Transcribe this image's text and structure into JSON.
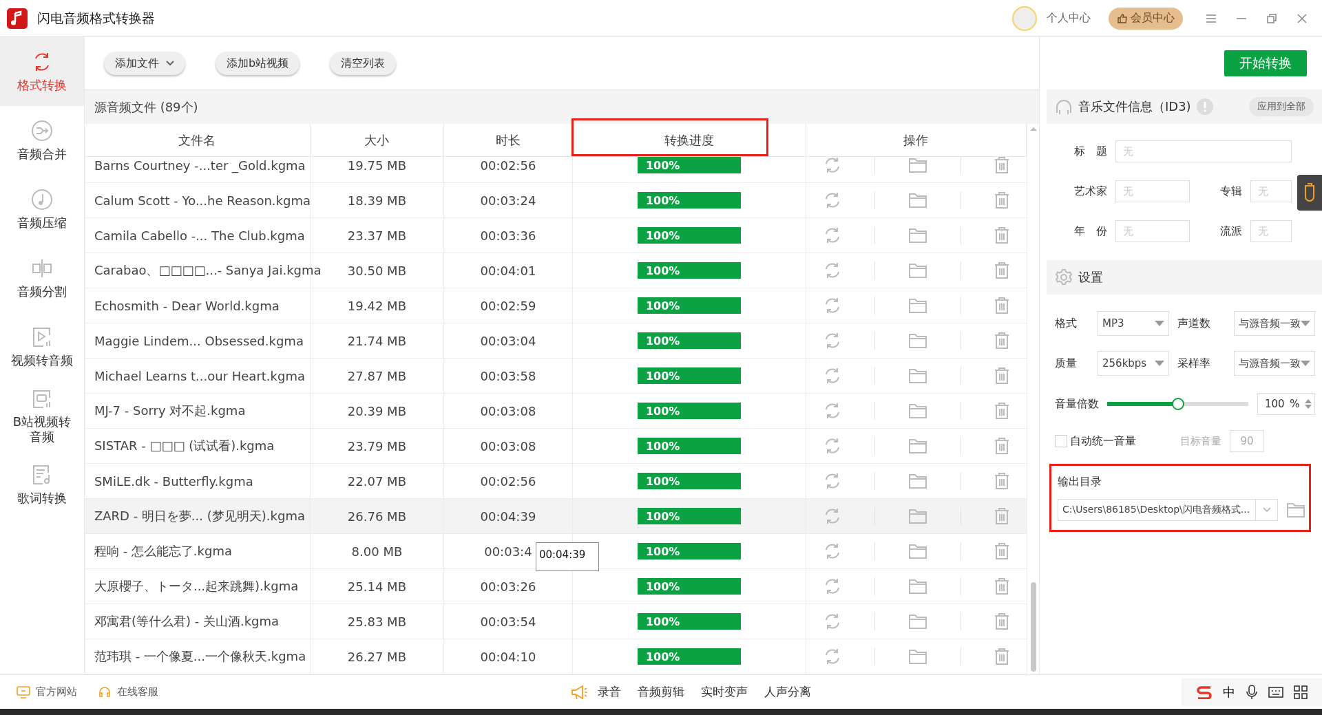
{
  "window": {
    "title": "闪电音频格式转换器",
    "user_label": "个人中心",
    "vip_button": "会员中心"
  },
  "sidebar": {
    "items": [
      {
        "label": "格式转换",
        "selected": true
      },
      {
        "label": "音频合并",
        "selected": false
      },
      {
        "label": "音频压缩",
        "selected": false
      },
      {
        "label": "音频分割",
        "selected": false
      },
      {
        "label": "视频转音频",
        "selected": false
      },
      {
        "label": "B站视频转音频",
        "selected": false
      },
      {
        "label": "歌词转换",
        "selected": false
      }
    ]
  },
  "toolbar": {
    "buttons": [
      {
        "label": "添加文件",
        "dropdown": true
      },
      {
        "label": "添加b站视频",
        "dropdown": false
      },
      {
        "label": "清空列表",
        "dropdown": false
      }
    ],
    "start_button": "开始转换"
  },
  "file_list": {
    "title": "源音频文件 (89个)",
    "columns": [
      {
        "label": "文件名",
        "highlighted": false
      },
      {
        "label": "大小",
        "highlighted": false
      },
      {
        "label": "时长",
        "highlighted": false
      },
      {
        "label": "转换进度",
        "highlighted": true
      },
      {
        "label": "操作",
        "highlighted": false
      }
    ],
    "rows": [
      {
        "name": "Barns Courtney -...ter _Gold.kgma",
        "size": "19.75 MB",
        "duration": "00:02:56",
        "progress": "100%",
        "level": 1,
        "hovered": false
      },
      {
        "name": "Calum Scott - Yo...he Reason.kgma",
        "size": "18.39 MB",
        "duration": "00:03:24",
        "progress": "100%",
        "level": 1,
        "hovered": false
      },
      {
        "name": "Camila Cabello -... The Club.kgma",
        "size": "23.37 MB",
        "duration": "00:03:36",
        "progress": "100%",
        "level": 1,
        "hovered": false
      },
      {
        "name": "Carabao、□□□□...- Sanya Jai.kgma",
        "size": "30.50 MB",
        "duration": "00:04:01",
        "progress": "100%",
        "level": 1,
        "hovered": false
      },
      {
        "name": "Echosmith - Dear World.kgma",
        "size": "19.42 MB",
        "duration": "00:02:59",
        "progress": "100%",
        "level": 1,
        "hovered": false
      },
      {
        "name": "Maggie Lindem... Obsessed.kgma",
        "size": "21.74 MB",
        "duration": "00:03:04",
        "progress": "100%",
        "level": 1,
        "hovered": false
      },
      {
        "name": "Michael Learns t...our Heart.kgma",
        "size": "27.87 MB",
        "duration": "00:03:58",
        "progress": "100%",
        "level": 1,
        "hovered": false
      },
      {
        "name": "MJ-7 - Sorry 对不起.kgma",
        "size": "20.39 MB",
        "duration": "00:03:08",
        "progress": "100%",
        "level": 1,
        "hovered": false
      },
      {
        "name": "SISTAR - □□□ (试试看).kgma",
        "size": "23.79 MB",
        "duration": "00:03:08",
        "progress": "100%",
        "level": 1,
        "hovered": false
      },
      {
        "name": "SMiLE.dk - Butterfly.kgma",
        "size": "22.07 MB",
        "duration": "00:02:56",
        "progress": "100%",
        "level": 1,
        "hovered": false
      },
      {
        "name": "ZARD - 明日を夢... (梦见明天).kgma",
        "size": "26.76 MB",
        "duration": "00:04:39",
        "progress": "100%",
        "level": 1,
        "hovered": true
      },
      {
        "name": "程响 - 怎么能忘了.kgma",
        "size": "8.00 MB",
        "duration": "00:03:4",
        "progress": "100%",
        "level": 1,
        "hovered": false,
        "tooltip": "00:04:39"
      },
      {
        "name": "大原櫻子、トータ...起来跳舞).kgma",
        "size": "25.14 MB",
        "duration": "00:03:26",
        "progress": "100%",
        "level": 1,
        "hovered": false
      },
      {
        "name": "邓寓君(等什么君) - 关山酒.kgma",
        "size": "25.83 MB",
        "duration": "00:03:54",
        "progress": "100%",
        "level": 1,
        "hovered": false
      },
      {
        "name": "范玮琪 - 一个像夏...一个像秋天.kgma",
        "size": "26.27 MB",
        "duration": "00:04:10",
        "progress": "100%",
        "level": 1,
        "hovered": false
      }
    ]
  },
  "id3": {
    "title": "音乐文件信息（ID3)",
    "apply_button": "应用到全部",
    "fields": [
      {
        "label": "标　题",
        "placeholder": "无",
        "wide": true
      },
      {
        "label": "艺术家",
        "placeholder": "无",
        "wide": false
      },
      {
        "label": "专辑",
        "placeholder": "无",
        "wide": false
      },
      {
        "label": "年　份",
        "placeholder": "无",
        "wide": false
      },
      {
        "label": "流派",
        "placeholder": "无",
        "wide": false
      }
    ]
  },
  "settings": {
    "title": "设置",
    "selects": [
      {
        "label": "格式",
        "value": "MP3"
      },
      {
        "label": "声道数",
        "value": "与源音频一致"
      },
      {
        "label": "质量",
        "value": "256kbps"
      },
      {
        "label": "采样率",
        "value": "与源音频一致"
      }
    ],
    "volume": {
      "label": "音量倍数",
      "level": 0.5,
      "value": "100",
      "unit": "%"
    },
    "auto_volume": {
      "label": "自动统一音量",
      "checked": false,
      "target_label": "目标音量",
      "target_value": "90"
    },
    "output": {
      "label": "输出目录",
      "path": "C:\\Users\\86185\\Desktop\\闪电音频格式...",
      "highlighted": true
    }
  },
  "bottom_bar": {
    "links": [
      "官方网站",
      "在线客服"
    ],
    "tools": [
      "录音",
      "音频剪辑",
      "实时变声",
      "人声分离"
    ],
    "tray_text": "中"
  }
}
